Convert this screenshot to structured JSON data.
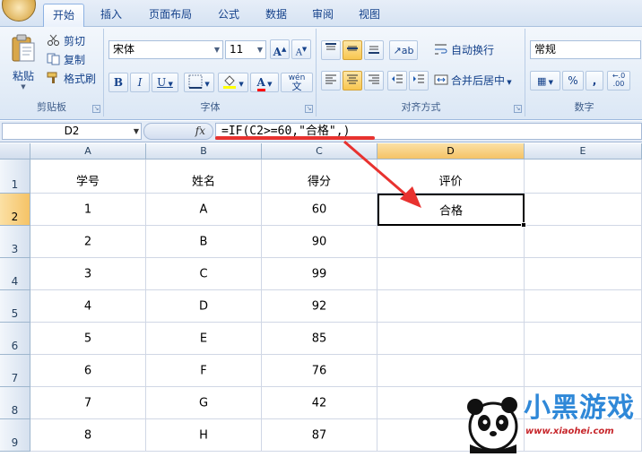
{
  "tabs": [
    {
      "label": "开始",
      "active": true
    },
    {
      "label": "插入"
    },
    {
      "label": "页面布局"
    },
    {
      "label": "公式"
    },
    {
      "label": "数据"
    },
    {
      "label": "审阅"
    },
    {
      "label": "视图"
    }
  ],
  "clipboard": {
    "paste": "粘贴",
    "cut": "剪切",
    "copy": "复制",
    "format_painter": "格式刷",
    "group_label": "剪贴板"
  },
  "font": {
    "name": "宋体",
    "size": "11",
    "grow": "A",
    "shrink": "A",
    "bold": "B",
    "italic": "I",
    "underline": "U",
    "color_glyph": "A",
    "phonetic": "wén",
    "phonetic_char": "文",
    "group_label": "字体"
  },
  "alignment": {
    "wrap_text": "自动换行",
    "merge_center": "合并后居中",
    "group_label": "对齐方式"
  },
  "number": {
    "format": "常规",
    "percent": "%",
    "comma": ",",
    "inc_decimal": "←.0 .00",
    "group_label": "数字"
  },
  "formula_bar": {
    "cell_ref": "D2",
    "fx": "fx",
    "formula": "=IF(C2>=60,\"合格\",)"
  },
  "columns": [
    "A",
    "B",
    "C",
    "D",
    "E"
  ],
  "rows": [
    "1",
    "2",
    "3",
    "4",
    "5",
    "6",
    "7",
    "8",
    "9"
  ],
  "headers": [
    "学号",
    "姓名",
    "得分",
    "评价"
  ],
  "table": [
    [
      "1",
      "A",
      "60",
      "合格"
    ],
    [
      "2",
      "B",
      "90",
      ""
    ],
    [
      "3",
      "C",
      "99",
      ""
    ],
    [
      "4",
      "D",
      "92",
      ""
    ],
    [
      "5",
      "E",
      "85",
      ""
    ],
    [
      "6",
      "F",
      "76",
      ""
    ],
    [
      "7",
      "G",
      "42",
      ""
    ],
    [
      "8",
      "H",
      "87",
      ""
    ]
  ],
  "watermark": {
    "title": "小黑游戏",
    "url": "www.xiaohei.com"
  },
  "colors": {
    "annotation": "#e8322f",
    "selected_header": "#f5c366",
    "ribbon_text": "#15428b"
  }
}
